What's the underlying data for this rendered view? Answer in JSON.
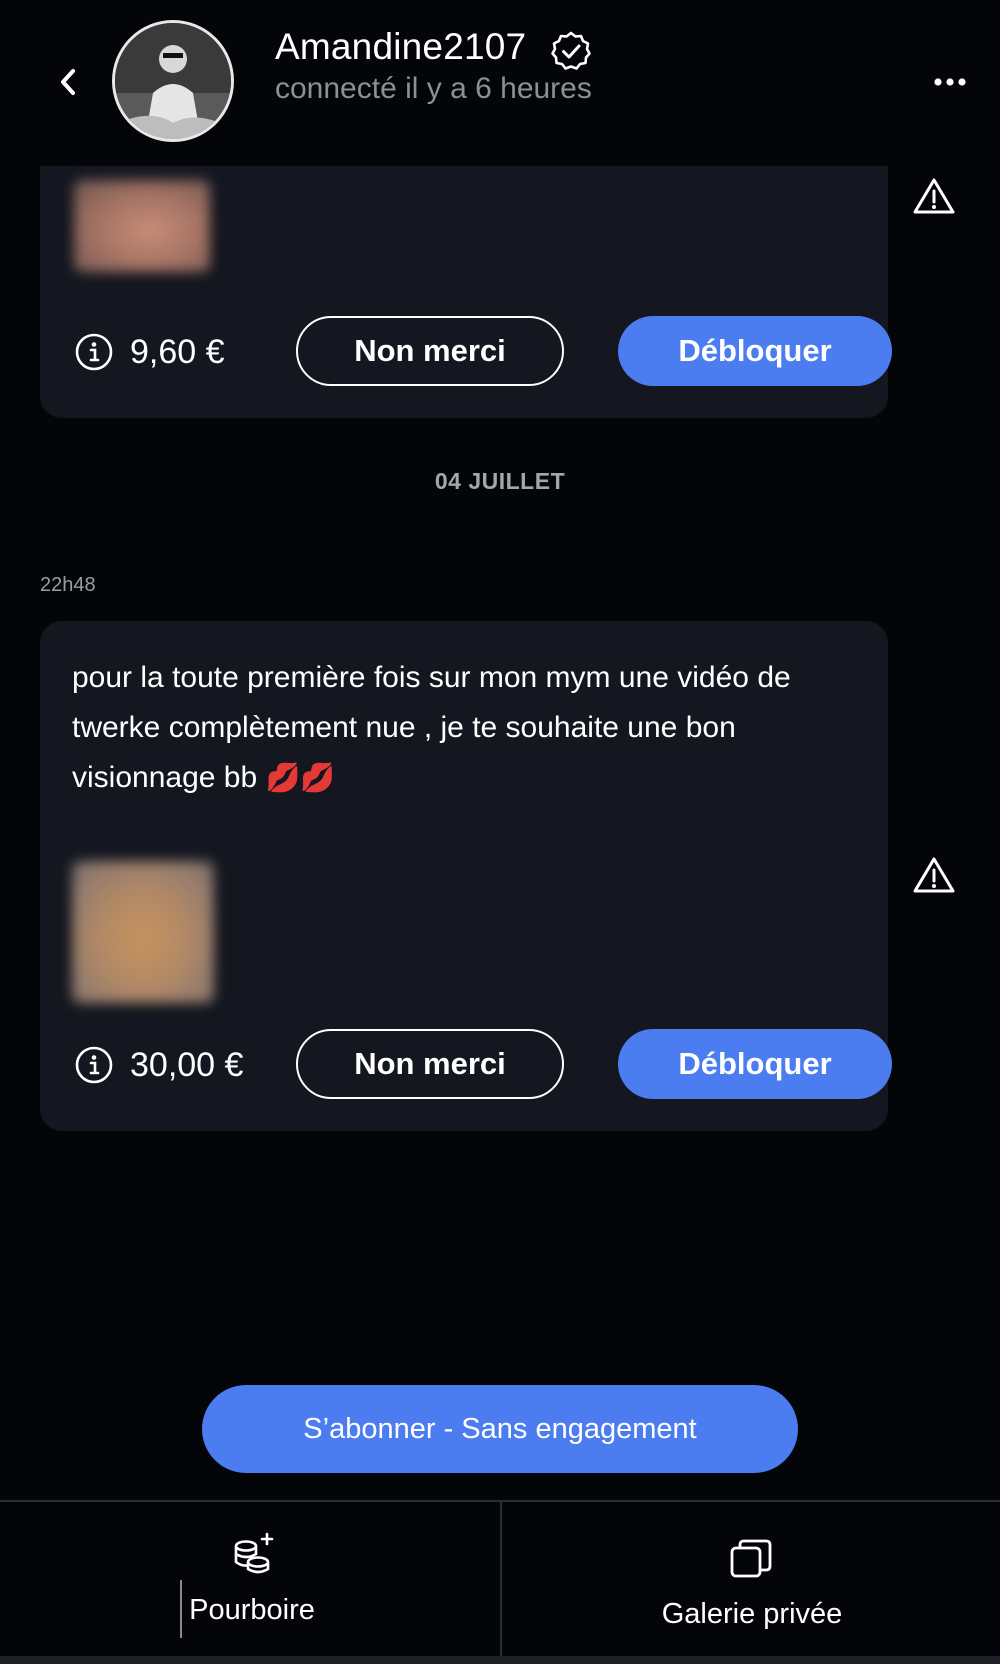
{
  "header": {
    "username": "Amandine2107",
    "status": "connecté il y a 6 heures",
    "icons": {
      "back": "chevron-left-icon",
      "verified": "verified-badge-icon",
      "more": "more-horizontal-icon"
    }
  },
  "messages": [
    {
      "price": "9,60 €",
      "decline_label": "Non merci",
      "unlock_label": "Débloquer"
    },
    {
      "time": "22h48",
      "text": "pour la toute première fois sur mon mym une vidéo de twerke complètement nue , je te souhaite une bon visionnage bb",
      "emoji": "💋💋",
      "price": "30,00 €",
      "decline_label": "Non merci",
      "unlock_label": "Débloquer"
    }
  ],
  "date_separator": "04 JUILLET",
  "subscribe_label": "S’abonner - Sans engagement",
  "bottom_nav": {
    "tip_label": "Pourboire",
    "gallery_label": "Galerie privée"
  },
  "colors": {
    "accent": "#4b7cf0",
    "background": "#040509",
    "bubble": "#141720"
  }
}
